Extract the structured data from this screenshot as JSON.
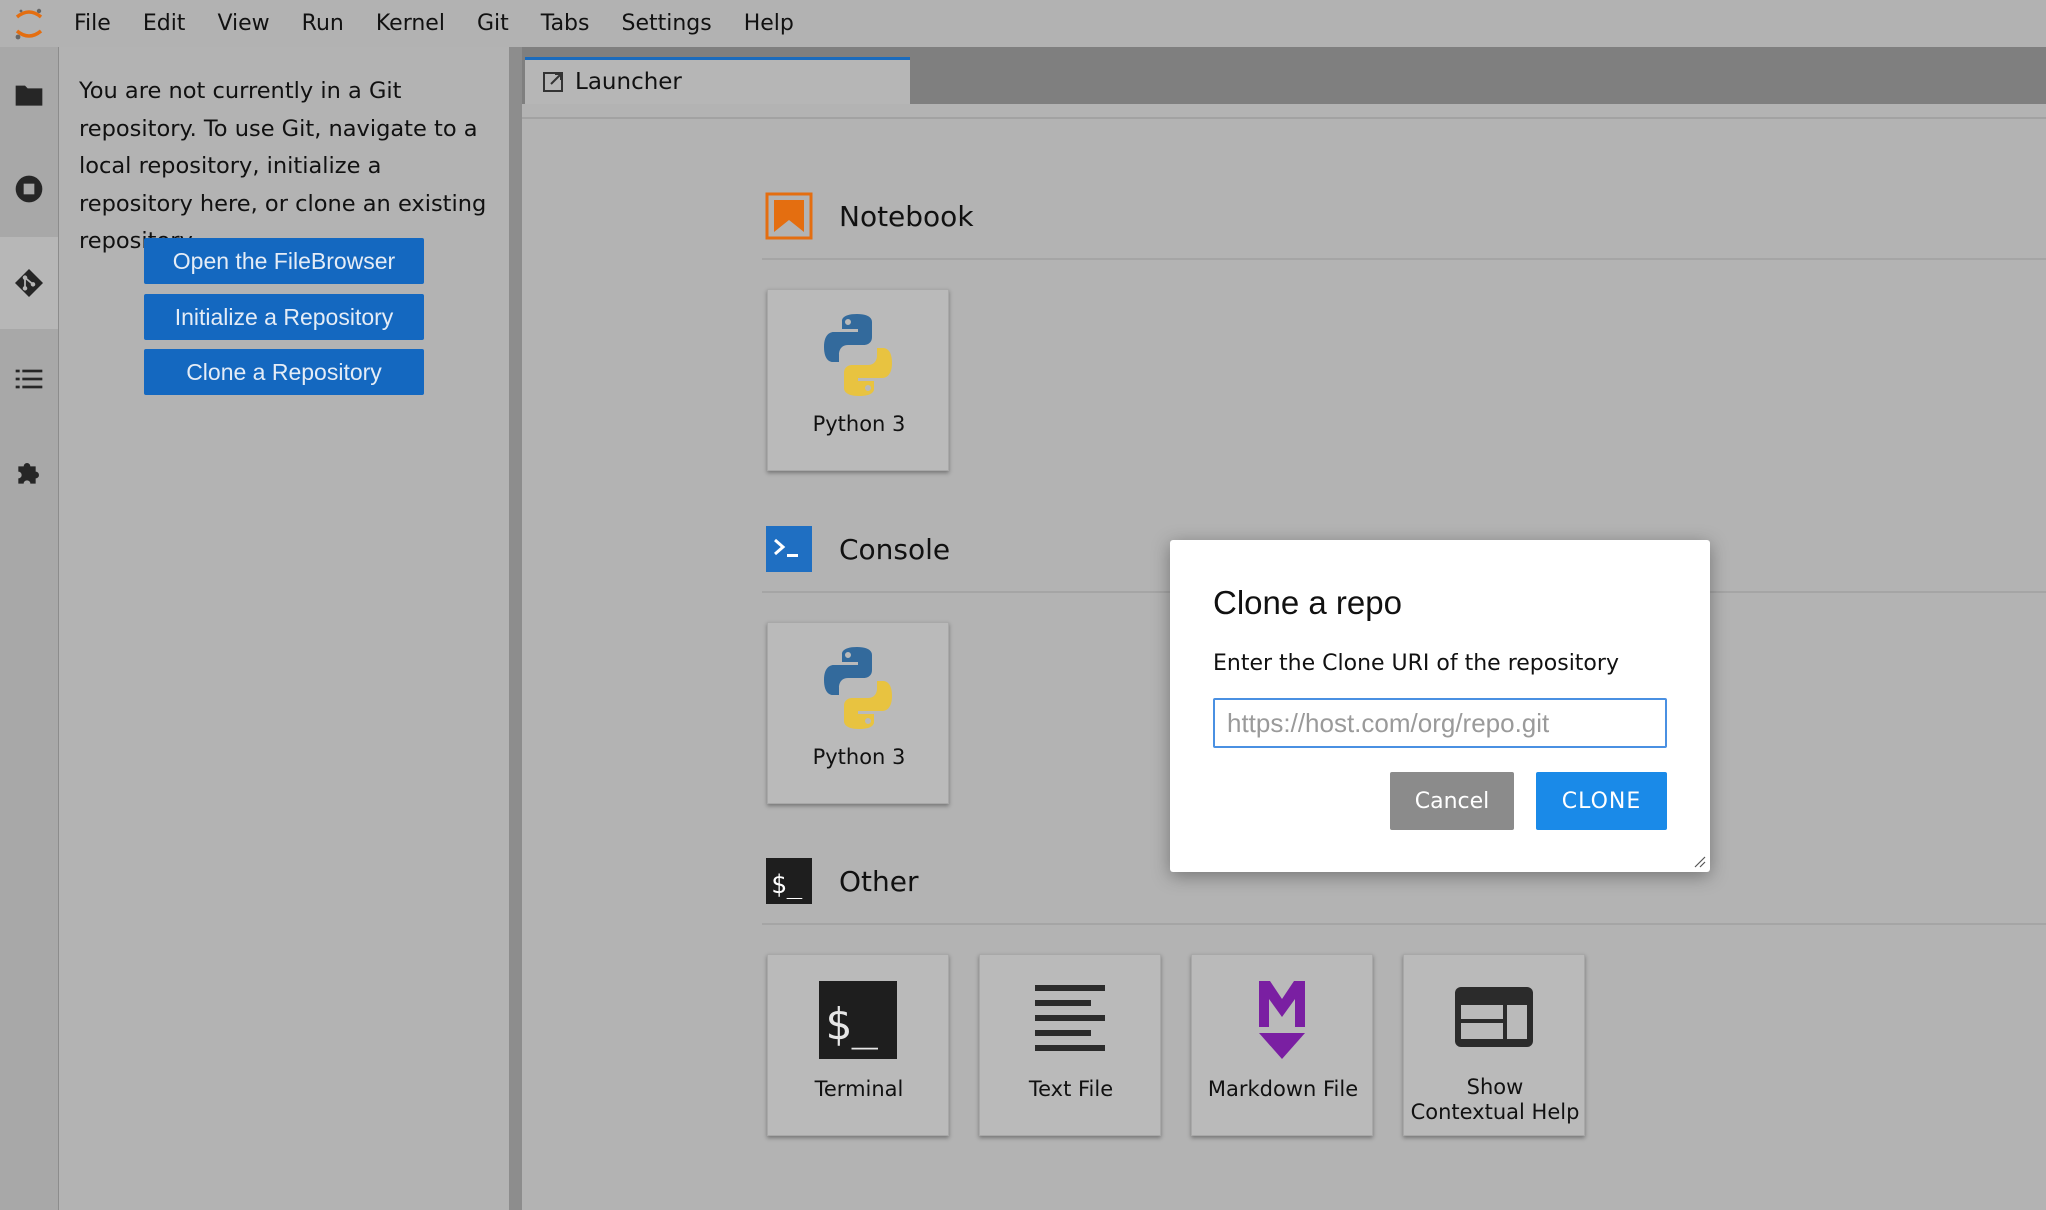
{
  "menubar": {
    "logo_icon": "jupyter-logo-icon",
    "items": [
      "File",
      "Edit",
      "View",
      "Run",
      "Kernel",
      "Git",
      "Tabs",
      "Settings",
      "Help"
    ]
  },
  "rail": {
    "icons": [
      "folder-icon",
      "stop-circle-icon",
      "git-icon",
      "list-icon",
      "puzzle-icon"
    ],
    "active": "git-icon"
  },
  "git_panel": {
    "message": "You are not currently in a Git repository. To use Git, navigate to a local repository, initialize a repository here, or clone an existing repository.",
    "buttons": {
      "open_filebrowser": "Open the FileBrowser",
      "init_repo": "Initialize a Repository",
      "clone_repo": "Clone a Repository"
    }
  },
  "tabs": [
    {
      "label": "Launcher",
      "icon": "launcher-icon"
    }
  ],
  "launcher": {
    "sections": {
      "notebook": {
        "title": "Notebook",
        "icon": "notebook-icon",
        "cards": [
          {
            "label": "Python 3",
            "icon": "python-icon"
          }
        ]
      },
      "console": {
        "title": "Console",
        "icon": "console-icon",
        "cards": [
          {
            "label": "Python 3",
            "icon": "python-icon"
          }
        ]
      },
      "other": {
        "title": "Other",
        "icon": "terminal-icon",
        "cards": [
          {
            "label": "Terminal",
            "icon": "terminal-icon"
          },
          {
            "label": "Text File",
            "icon": "text-file-icon"
          },
          {
            "label": "Markdown File",
            "icon": "markdown-icon"
          },
          {
            "label_line1": "Show",
            "label_line2": "Contextual Help",
            "icon": "contextual-help-icon"
          }
        ]
      }
    }
  },
  "dialog": {
    "title": "Clone a repo",
    "label": "Enter the Clone URI of the repository",
    "input_placeholder": "https://host.com/org/repo.git",
    "input_value": "",
    "cancel_label": "Cancel",
    "clone_label": "CLONE"
  },
  "colors": {
    "accent": "#1a8ae8",
    "git_button": "#1468c0",
    "notebook_orange": "#e46e10",
    "console_blue": "#1f6fc2",
    "markdown_purple": "#7a1fa2"
  }
}
